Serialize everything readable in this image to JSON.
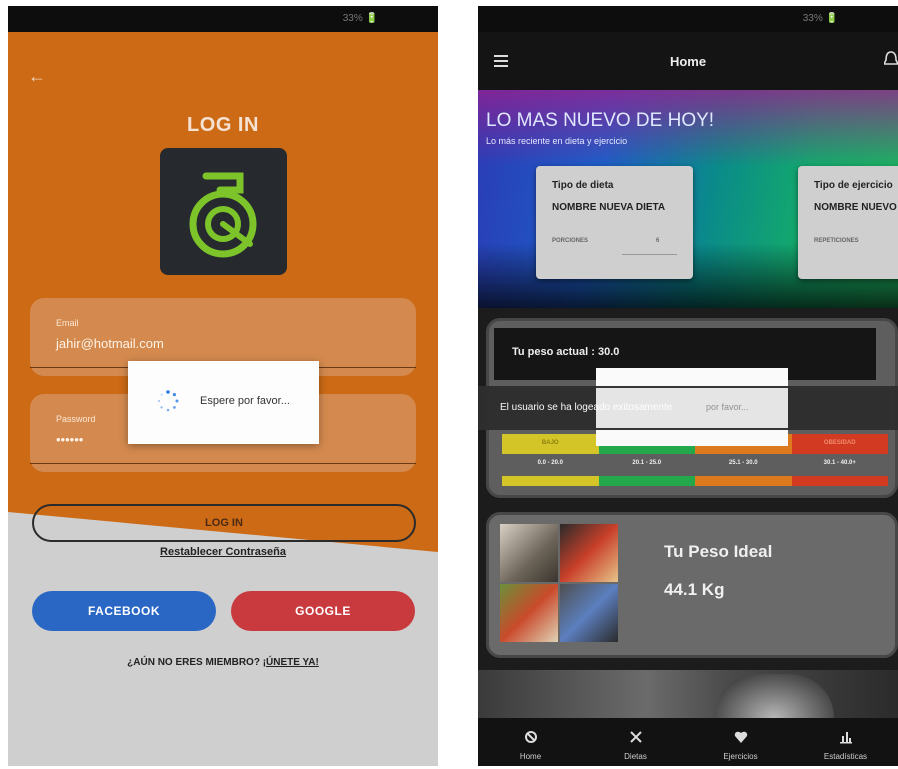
{
  "left_screen": {
    "status_bar": {
      "text": "33% 🔋"
    },
    "title": "LOG IN",
    "email_field": {
      "label": "Email",
      "value": "jahir@hotmail.com"
    },
    "password_field": {
      "label": "Password",
      "value": "••••••"
    },
    "loading_dialog": {
      "message": "Espere por favor..."
    },
    "login_button": {
      "label": "LOG IN"
    },
    "reset_link": {
      "label": "Restablecer Contraseña"
    },
    "facebook_button": {
      "label": "FACEBOOK"
    },
    "google_button": {
      "label": "GOOGLE"
    },
    "member_prompt": {
      "text": "¿AÚN NO ERES MIEMBRO?",
      "link": "¡ÚNETE YA!"
    },
    "colors": {
      "orange": "#cc6a15",
      "background": "#cfcfcf",
      "facebook": "#2a67c5",
      "google": "#c93a3f",
      "logo_green": "#7dc42b"
    },
    "icons": [
      "back-arrow-icon",
      "app-logo-icon",
      "spinner-icon"
    ]
  },
  "right_screen": {
    "status_bar": {
      "text": "33% 🔋"
    },
    "header": {
      "title": "Home"
    },
    "banner": {
      "title": "LO MAS NUEVO DE HOY!",
      "subtitle": "Lo más reciente en dieta y ejercicio"
    },
    "diet_card": {
      "heading": "Tipo de dieta",
      "name": "NOMBRE NUEVA DIETA",
      "detail_label": "PORCIONES",
      "detail_value": "6"
    },
    "exercise_card": {
      "heading": "Tipo de ejercicio",
      "name": "NOMBRE NUEVO",
      "detail_label": "REPETICIONES"
    },
    "weight": {
      "current_label": "Tu peso actual : 30.0"
    },
    "snackbar": {
      "message": "El usuario se ha logeado exitosamente",
      "dialog_text": "por favor..."
    },
    "bmi": {
      "labels": [
        "BAJO",
        "",
        "",
        "OBESIDAD"
      ],
      "ranges": [
        "0.0 - 20.0",
        "20.1 - 25.0",
        "25.1 - 30.0",
        "30.1 - 40.0+"
      ],
      "colors": [
        "#d3c527",
        "#23a94c",
        "#dc7a1d",
        "#d23a22"
      ]
    },
    "ideal": {
      "title": "Tu Peso Ideal",
      "value": "44.1 Kg"
    },
    "nav": [
      {
        "label": "Home",
        "icon": "home-icon"
      },
      {
        "label": "Dietas",
        "icon": "utensils-icon"
      },
      {
        "label": "Ejercicios",
        "icon": "heart-shield-icon"
      },
      {
        "label": "Estadísticas",
        "icon": "stats-icon"
      }
    ],
    "colors": {
      "dark": "#1c1c1c",
      "panel": "#5e5e5e",
      "card": "#cfcfcf"
    }
  }
}
